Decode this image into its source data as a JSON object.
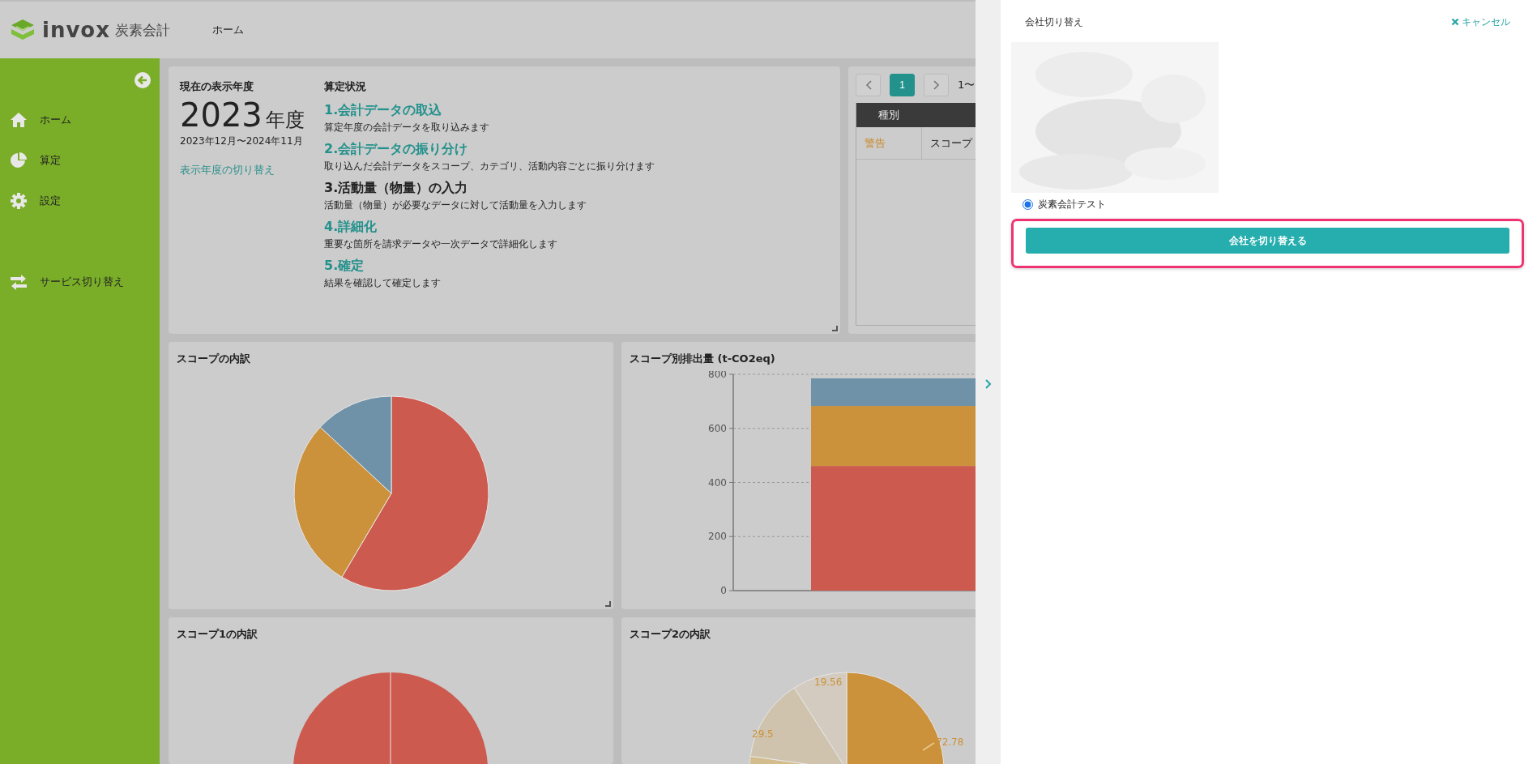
{
  "header": {
    "logo_text": "invox",
    "logo_subtext": "炭素会計",
    "nav": [
      {
        "label": "ホーム"
      }
    ]
  },
  "sidebar": {
    "items": [
      {
        "label": "ホーム",
        "kind": "home"
      },
      {
        "label": "算定",
        "kind": "pie"
      },
      {
        "label": "設定",
        "kind": "gear"
      }
    ],
    "footer_items": [
      {
        "label": "サービス切り替え",
        "kind": "switch"
      }
    ]
  },
  "year_panel": {
    "heading": "現在の表示年度",
    "year": "2023",
    "year_suffix": "年度",
    "period": "2023年12月〜2024年11月",
    "switch_link": "表示年度の切り替え"
  },
  "status_panel": {
    "heading": "算定状況",
    "steps": [
      {
        "title": "1.会計データの取込",
        "description": "算定年度の会計データを取り込みます",
        "link": true
      },
      {
        "title": "2.会計データの振り分け",
        "description": "取り込んだ会計データをスコープ、カテゴリ、活動内容ごとに振り分けます",
        "link": true
      },
      {
        "title": "3.活動量（物量）の入力",
        "description": "活動量（物量）が必要なデータに対して活動量を入力します",
        "link": false
      },
      {
        "title": "4.詳細化",
        "description": "重要な箇所を請求データや一次データで詳細化します",
        "link": true
      },
      {
        "title": "5.確定",
        "description": "結果を確認して確定します",
        "link": true
      }
    ]
  },
  "alerts_panel": {
    "pages": [
      {
        "label": "1",
        "selected": true
      }
    ],
    "range": "1〜",
    "columns": [
      "種別"
    ],
    "rows": [
      {
        "cells": [
          "警告",
          "スコープ"
        ]
      }
    ]
  },
  "charts": [
    {
      "title": "スコープの内訳",
      "kind": "pie"
    },
    {
      "title": "スコープ別排出量 (t-CO2eq)",
      "kind": "bar",
      "chart_data": {
        "type": "bar",
        "stacked": true,
        "grid": true,
        "ylim": [
          0,
          800
        ],
        "yticks": [
          0,
          200,
          400,
          600,
          800
        ],
        "series": [
          {
            "color": "#cd5a4e",
            "values": [
              461
            ]
          },
          {
            "color": "#cb923b",
            "values": [
              222
            ]
          },
          {
            "color": "#6f92a8",
            "values": [
              102
            ]
          }
        ]
      }
    },
    {
      "title": "スコープ1の内訳",
      "kind": "pie_full"
    },
    {
      "title": "スコープ2の内訳",
      "kind": "pie_labels",
      "slice_labels": [
        "19.56",
        "29.5",
        "72.78"
      ]
    }
  ],
  "drawer": {
    "title": "会社切り替え",
    "cancel": "キャンセル",
    "companies": [
      {
        "label": "炭素会計テスト",
        "selected": true
      }
    ],
    "submit": "会社を切り替える",
    "highlighted": true
  }
}
